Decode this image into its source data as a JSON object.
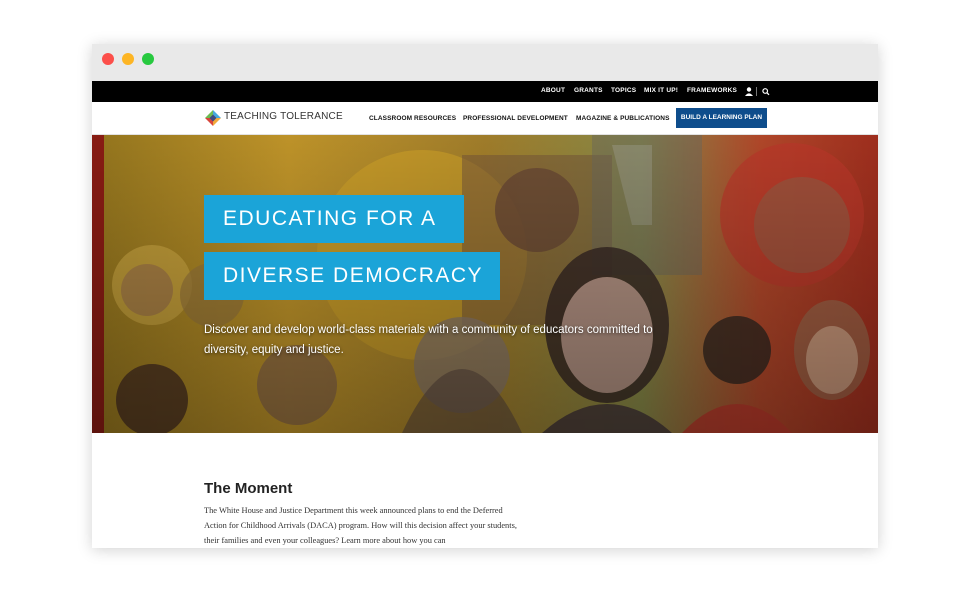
{
  "colors": {
    "utility_bar": "#000000",
    "cta_background": "#0e4d8c",
    "headline_background": "#1ba4d8",
    "window_close": "#fc4f4a",
    "window_minimize": "#fdb524",
    "window_zoom": "#27c93f"
  },
  "utility_nav": {
    "items": [
      "ABOUT",
      "GRANTS",
      "TOPICS",
      "MIX IT UP!",
      "FRAMEWORKS"
    ],
    "icons": [
      "user-icon",
      "search-icon"
    ]
  },
  "brand": {
    "name": "TEACHING TOLERANCE"
  },
  "main_nav": {
    "items": [
      "CLASSROOM RESOURCES",
      "PROFESSIONAL DEVELOPMENT",
      "MAGAZINE & PUBLICATIONS"
    ],
    "cta": "BUILD A LEARNING PLAN"
  },
  "hero": {
    "headline_line1": "EDUCATING FOR A",
    "headline_line2": "DIVERSE DEMOCRACY",
    "subtext": "Discover and develop world-class materials with a community of educators committed to diversity, equity and justice."
  },
  "moment": {
    "title": "The Moment",
    "body": "The White House and Justice Department this week announced plans to end the Deferred Action for Childhood Arrivals (DACA) program. How will this decision affect your students, their families and even your colleagues? Learn more about how you can"
  }
}
